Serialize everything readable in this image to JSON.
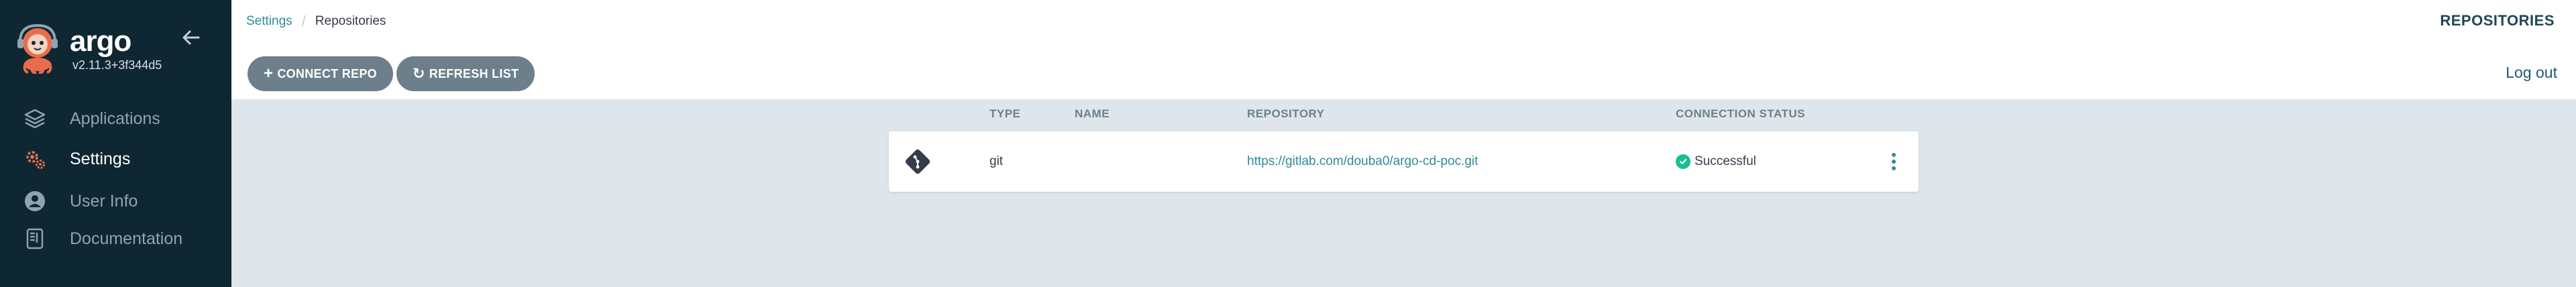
{
  "sidebar": {
    "logo_text": "argo",
    "version": "v2.11.3+3f344d5",
    "items": [
      {
        "label": "Applications",
        "icon": "layers-icon"
      },
      {
        "label": "Settings",
        "icon": "gear-icon"
      },
      {
        "label": "User Info",
        "icon": "user-circle-icon"
      },
      {
        "label": "Documentation",
        "icon": "book-icon"
      }
    ],
    "active_item": "Settings"
  },
  "breadcrumb": {
    "parent": "Settings",
    "current": "Repositories"
  },
  "header": {
    "title": "REPOSITORIES",
    "logout": "Log out"
  },
  "toolbar": {
    "connect_repo": "CONNECT REPO",
    "refresh_list": "REFRESH LIST"
  },
  "table": {
    "columns": [
      "TYPE",
      "NAME",
      "REPOSITORY",
      "CONNECTION STATUS"
    ],
    "rows": [
      {
        "type": "git",
        "name": "",
        "repository": "https://gitlab.com/douba0/argo-cd-poc.git",
        "status": "Successful"
      }
    ]
  },
  "colors": {
    "sidebar_bg": "#0f2733",
    "accent": "#2e8b99",
    "success": "#18be94",
    "button_bg": "#6d7f8b",
    "content_bg": "#dee6eb"
  }
}
